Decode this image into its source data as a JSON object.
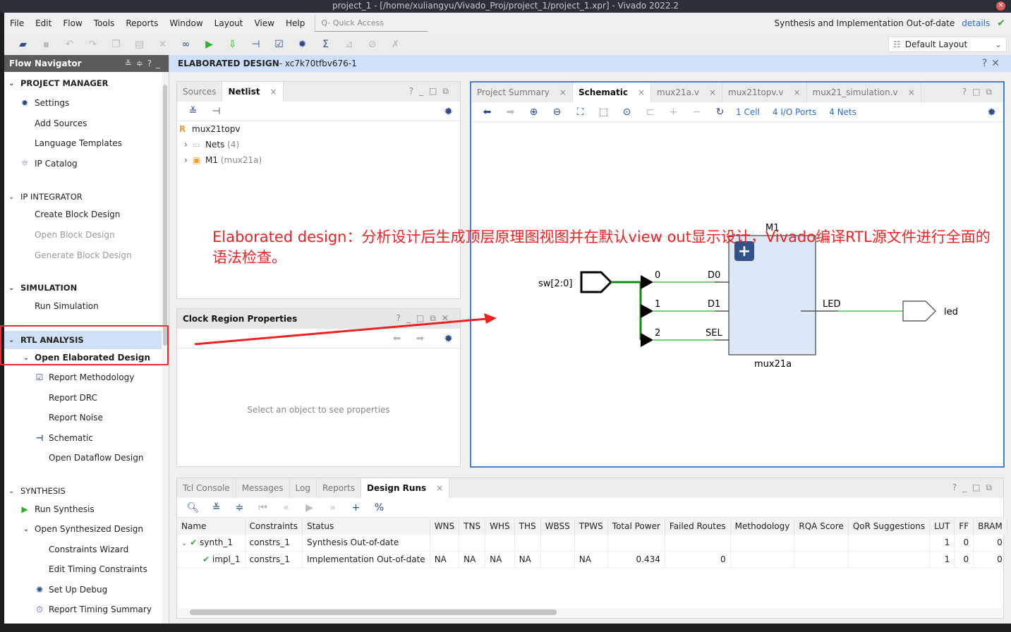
{
  "window": {
    "title": "project_1 - [/home/xuliangyu/Vivado_Proj/project_1/project_1.xpr] - Vivado 2022.2"
  },
  "menu": {
    "items": [
      "File",
      "Edit",
      "Flow",
      "Tools",
      "Reports",
      "Window",
      "Layout",
      "View",
      "Help"
    ],
    "quick_access_placeholder": "Q- Quick Access",
    "status_text": "Synthesis and Implementation Out-of-date",
    "details_link": "details"
  },
  "toolbar": {
    "layout_select": "Default Layout",
    "icons": [
      "open-project-icon",
      "save-icon",
      "undo-icon",
      "redo-icon",
      "copy-icon",
      "paste-icon",
      "delete-icon",
      "find-icon",
      "run-icon",
      "program-icon",
      "schematic-icon",
      "report-icon",
      "settings-icon",
      "sigma-icon",
      "disabled-icon-1",
      "disabled-icon-2",
      "disabled-icon-3"
    ]
  },
  "flow_navigator": {
    "title": "Flow Navigator",
    "sections": [
      {
        "label": "PROJECT MANAGER",
        "items": [
          "Settings",
          "Add Sources",
          "Language Templates",
          "IP Catalog"
        ]
      },
      {
        "label": "IP INTEGRATOR",
        "items": [
          "Create Block Design",
          "Open Block Design",
          "Generate Block Design"
        ]
      },
      {
        "label": "SIMULATION",
        "items": [
          "Run Simulation"
        ]
      },
      {
        "label": "RTL ANALYSIS",
        "items": [
          "Open Elaborated Design",
          "Report Methodology",
          "Report DRC",
          "Report Noise",
          "Schematic",
          "Open Dataflow Design"
        ]
      },
      {
        "label": "SYNTHESIS",
        "items": [
          "Run Synthesis",
          "Open Synthesized Design",
          "Constraints Wizard",
          "Edit Timing Constraints",
          "Set Up Debug",
          "Report Timing Summary"
        ]
      }
    ]
  },
  "main_header": {
    "title": "ELABORATED DESIGN",
    "part": " - xc7k70tfbv676-1"
  },
  "netlist_panel": {
    "tabs": [
      "Sources",
      "Netlist"
    ],
    "active_tab": "Netlist",
    "tree": {
      "root": "mux21topv",
      "nets_label": "Nets",
      "nets_count": "(4)",
      "cell_label": "M1",
      "cell_type": "(mux21a)"
    }
  },
  "properties_panel": {
    "title": "Clock Region Properties",
    "empty_message": "Select an object to see properties"
  },
  "schematic_panel": {
    "tabs": [
      "Project Summary",
      "Schematic",
      "mux21a.v",
      "mux21topv.v",
      "mux21_simulation.v"
    ],
    "active_tab": "Schematic",
    "stats": {
      "cells": "1 Cell",
      "ports": "4 I/O Ports",
      "nets": "4 Nets"
    },
    "diagram": {
      "input_port": "sw[2:0]",
      "bits": [
        "0",
        "1",
        "2"
      ],
      "cell_name": "M1",
      "cell_type": "mux21a",
      "cell_inputs": [
        "D0",
        "D1",
        "SEL"
      ],
      "cell_output": "LED",
      "output_port": "led"
    }
  },
  "annotation": "Elaborated design：分析设计后生成顶层原理图视图并在默认view out显示设计，Vivado编译RTL源文件进行全面的语法检查。",
  "bottom_panel": {
    "tabs": [
      "Tcl Console",
      "Messages",
      "Log",
      "Reports",
      "Design Runs"
    ],
    "active_tab": "Design Runs",
    "columns": [
      "Name",
      "Constraints",
      "Status",
      "WNS",
      "TNS",
      "WHS",
      "THS",
      "WBSS",
      "TPWS",
      "Total Power",
      "Failed Routes",
      "Methodology",
      "RQA Score",
      "QoR Suggestions",
      "LUT",
      "FF",
      "BRAM"
    ],
    "rows": [
      {
        "name": "synth_1",
        "constraints": "constrs_1",
        "status": "Synthesis Out-of-date",
        "wns": "",
        "tns": "",
        "whs": "",
        "ths": "",
        "wbss": "",
        "tpws": "",
        "power": "",
        "failed": "",
        "method": "",
        "rqa": "",
        "qor": "",
        "lut": "1",
        "ff": "0",
        "bram": "0"
      },
      {
        "name": "impl_1",
        "constraints": "constrs_1",
        "status": "Implementation Out-of-date",
        "wns": "NA",
        "tns": "NA",
        "whs": "NA",
        "ths": "NA",
        "wbss": "",
        "tpws": "NA",
        "power": "0.434",
        "failed": "0",
        "method": "",
        "rqa": "",
        "qor": "",
        "lut": "1",
        "ff": "0",
        "bram": "0"
      }
    ]
  },
  "colors": {
    "accent": "#2d4a8a",
    "selection": "#cfe0f7",
    "annotation": "#ee2222",
    "net": "#7ccf7c",
    "bus": "#138a13"
  }
}
